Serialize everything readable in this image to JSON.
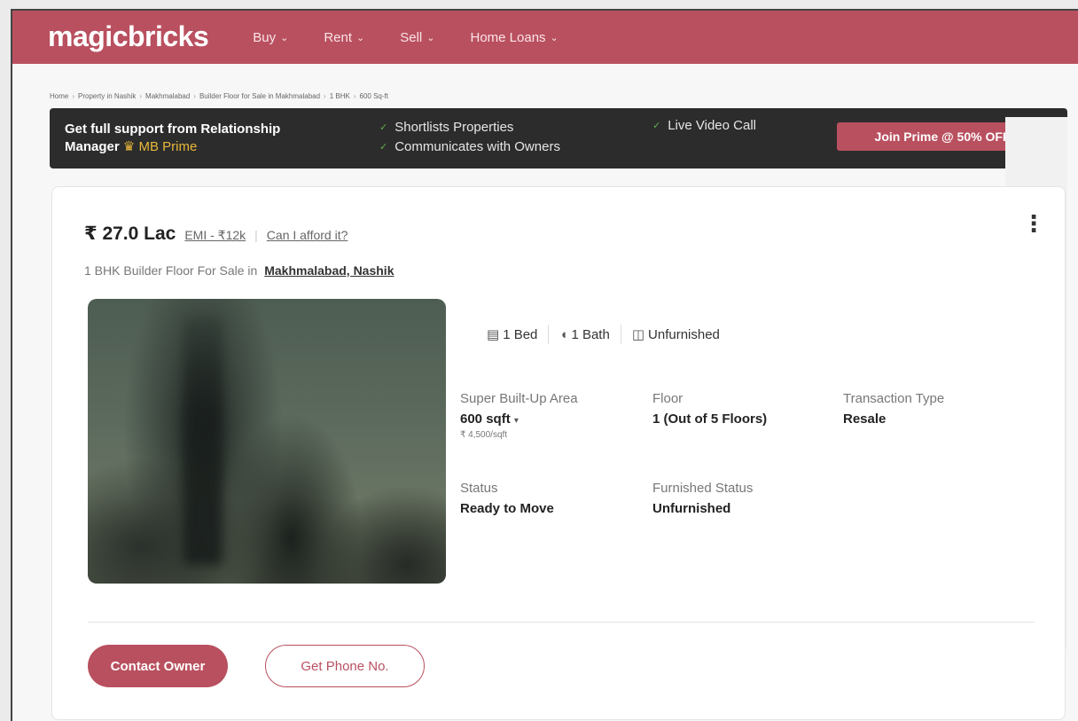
{
  "nav": {
    "logo": "magicbricks",
    "items": [
      {
        "label": "Buy"
      },
      {
        "label": "Rent"
      },
      {
        "label": "Sell"
      },
      {
        "label": "Home Loans"
      }
    ]
  },
  "breadcrumb": [
    "Home",
    "Property in Nashik",
    "Makhmalabad",
    "Builder Floor for Sale in Makhmalabad",
    "1 BHK",
    "600 Sq-ft"
  ],
  "prime": {
    "text_line1": "Get full support from Relationship",
    "text_line2": "Manager",
    "badge": "MB Prime",
    "features": [
      "Shortlists Properties",
      "Communicates with Owners",
      "Live Video Call"
    ],
    "cta": "Join Prime @ 50% OFF"
  },
  "listing": {
    "price": "₹ 27.0 Lac",
    "emi": "EMI - ₹12k",
    "afford": "Can I afford it?",
    "subtitle_prefix": "1 BHK Builder Floor For Sale in",
    "location": "Makhmalabad, Nashik",
    "features": [
      {
        "icon": "bed-icon",
        "label": "1 Bed"
      },
      {
        "icon": "bath-icon",
        "label": "1 Bath"
      },
      {
        "icon": "furnish-icon",
        "label": "Unfurnished"
      }
    ],
    "specs": {
      "area_label": "Super Built-Up Area",
      "area_value": "600 sqft",
      "area_rate": "₹ 4,500/sqft",
      "floor_label": "Floor",
      "floor_value": "1 (Out of 5 Floors)",
      "transaction_label": "Transaction Type",
      "transaction_value": "Resale",
      "status_label": "Status",
      "status_value": "Ready to Move",
      "furnished_label": "Furnished Status",
      "furnished_value": "Unfurnished"
    },
    "contact_button": "Contact Owner",
    "phone_button": "Get Phone No."
  },
  "colors": {
    "brand": "#b9505f",
    "banner": "#2c2c2c",
    "gold": "#e8b83a"
  }
}
